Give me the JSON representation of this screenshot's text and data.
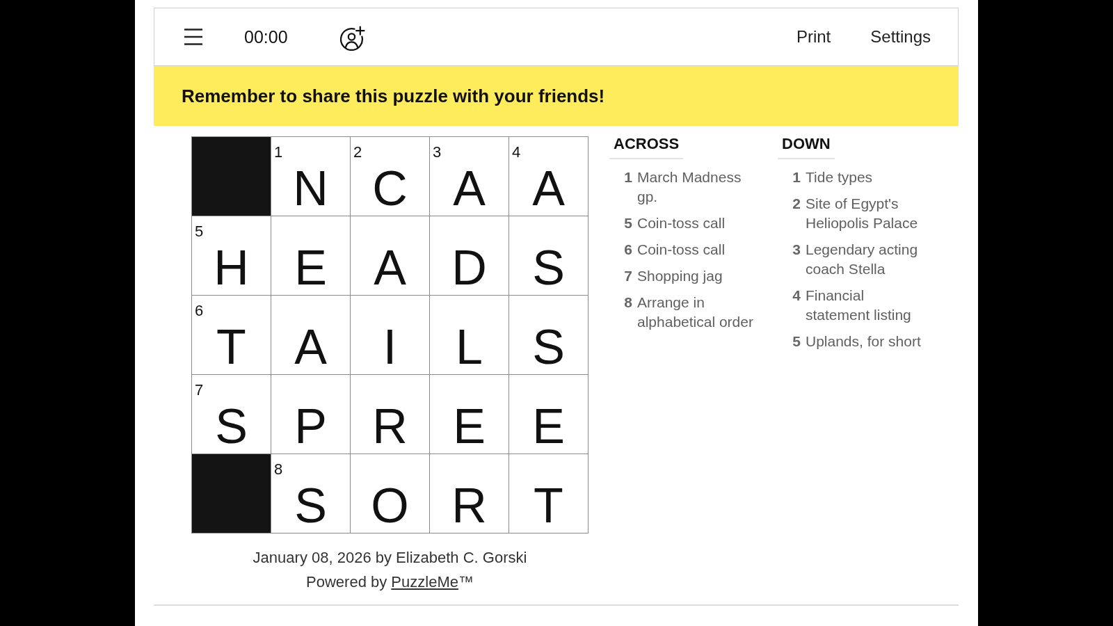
{
  "toolbar": {
    "timer": "00:00",
    "actions": [
      {
        "label": "Print"
      },
      {
        "label": "Settings"
      }
    ]
  },
  "banner": {
    "text": "Remember to share this puzzle with your friends!"
  },
  "grid": {
    "rows": [
      [
        {
          "kind": "block"
        },
        {
          "kind": "open",
          "number": "1",
          "letter": "N"
        },
        {
          "kind": "open",
          "number": "2",
          "letter": "C"
        },
        {
          "kind": "open",
          "number": "3",
          "letter": "A"
        },
        {
          "kind": "open",
          "number": "4",
          "letter": "A"
        }
      ],
      [
        {
          "kind": "open",
          "number": "5",
          "letter": "H"
        },
        {
          "kind": "open",
          "letter": "E"
        },
        {
          "kind": "open",
          "letter": "A"
        },
        {
          "kind": "open",
          "letter": "D"
        },
        {
          "kind": "open",
          "letter": "S"
        }
      ],
      [
        {
          "kind": "open",
          "number": "6",
          "letter": "T"
        },
        {
          "kind": "open",
          "letter": "A"
        },
        {
          "kind": "open",
          "letter": "I"
        },
        {
          "kind": "open",
          "letter": "L"
        },
        {
          "kind": "open",
          "letter": "S"
        }
      ],
      [
        {
          "kind": "open",
          "number": "7",
          "letter": "S"
        },
        {
          "kind": "open",
          "letter": "P"
        },
        {
          "kind": "open",
          "letter": "R"
        },
        {
          "kind": "open",
          "letter": "E"
        },
        {
          "kind": "open",
          "letter": "E"
        }
      ],
      [
        {
          "kind": "block"
        },
        {
          "kind": "open",
          "number": "8",
          "letter": "S"
        },
        {
          "kind": "open",
          "letter": "O"
        },
        {
          "kind": "open",
          "letter": "R"
        },
        {
          "kind": "open",
          "letter": "T"
        }
      ]
    ]
  },
  "clue_lists": [
    {
      "heading": "ACROSS",
      "clues": [
        {
          "number": "1",
          "text": "March Madness gp."
        },
        {
          "number": "5",
          "text": "Coin-toss call"
        },
        {
          "number": "6",
          "text": "Coin-toss call"
        },
        {
          "number": "7",
          "text": "Shopping jag"
        },
        {
          "number": "8",
          "text": "Arrange in alphabetical order"
        }
      ]
    },
    {
      "heading": "DOWN",
      "clues": [
        {
          "number": "1",
          "text": "Tide types"
        },
        {
          "number": "2",
          "text": "Site of Egypt's Heliopolis Palace"
        },
        {
          "number": "3",
          "text": "Legendary acting coach Stella"
        },
        {
          "number": "4",
          "text": "Financial statement listing"
        },
        {
          "number": "5",
          "text": "Uplands, for short"
        }
      ]
    }
  ],
  "footer": {
    "byline": "January 08, 2026 by Elizabeth C. Gorski",
    "credit_prefix": "Powered by",
    "credit_link": "PuzzleMe",
    "credit_suffix": "™"
  }
}
